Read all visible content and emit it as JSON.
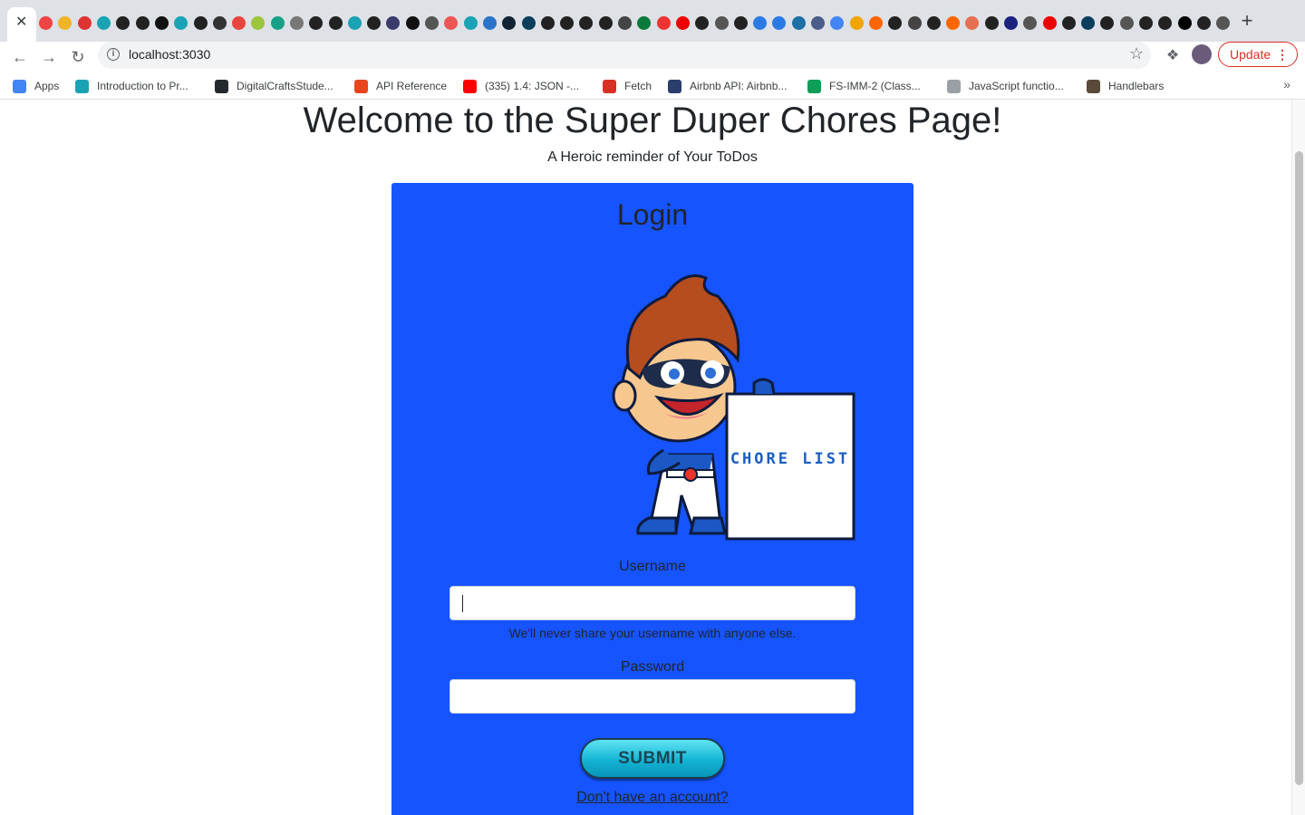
{
  "browser": {
    "tab_close_glyph": "✕",
    "new_tab_glyph": "+",
    "url": "localhost:3030",
    "update_label": "Update",
    "bookmarks": [
      {
        "label": "Apps",
        "icon": "apps-grid-icon",
        "color": "#4285f4"
      },
      {
        "label": "Introduction to Pr...",
        "icon": "link-icon",
        "color": "#1aa3b4"
      },
      {
        "label": "DigitalCraftsStude...",
        "icon": "github-icon",
        "color": "#24292e"
      },
      {
        "label": "API Reference",
        "icon": "api-icon",
        "color": "#e8461e"
      },
      {
        "label": "(335) 1.4: JSON -...",
        "icon": "youtube-icon",
        "color": "#ff0000"
      },
      {
        "label": "Fetch",
        "icon": "fetch-icon",
        "color": "#d93025"
      },
      {
        "label": "Airbnb API: Airbnb...",
        "icon": "airbnb-icon",
        "color": "#2a3d6b"
      },
      {
        "label": "FS-IMM-2 (Class...",
        "icon": "sheets-icon",
        "color": "#0f9d58"
      },
      {
        "label": "JavaScript functio...",
        "icon": "w3schools-icon",
        "color": "#9aa0a6"
      },
      {
        "label": "Handlebars",
        "icon": "handlebars-icon",
        "color": "#5a4a3a"
      }
    ]
  },
  "page": {
    "title": "Welcome to the Super Duper Chores Page!",
    "subtitle": "A Heroic reminder of Your ToDos",
    "login": {
      "heading": "Login",
      "hero_sign": "CHORE LIST",
      "username_label": "Username",
      "username_value": "",
      "username_help": "We'll never share your username with anyone else.",
      "password_label": "Password",
      "password_value": "",
      "submit_label": "SUBMIT",
      "signup_link": "Don't have an account?"
    }
  },
  "colors": {
    "card_bg": "#1654ff",
    "update_red": "#d93025",
    "submit_cyan": "#14b4d4"
  }
}
